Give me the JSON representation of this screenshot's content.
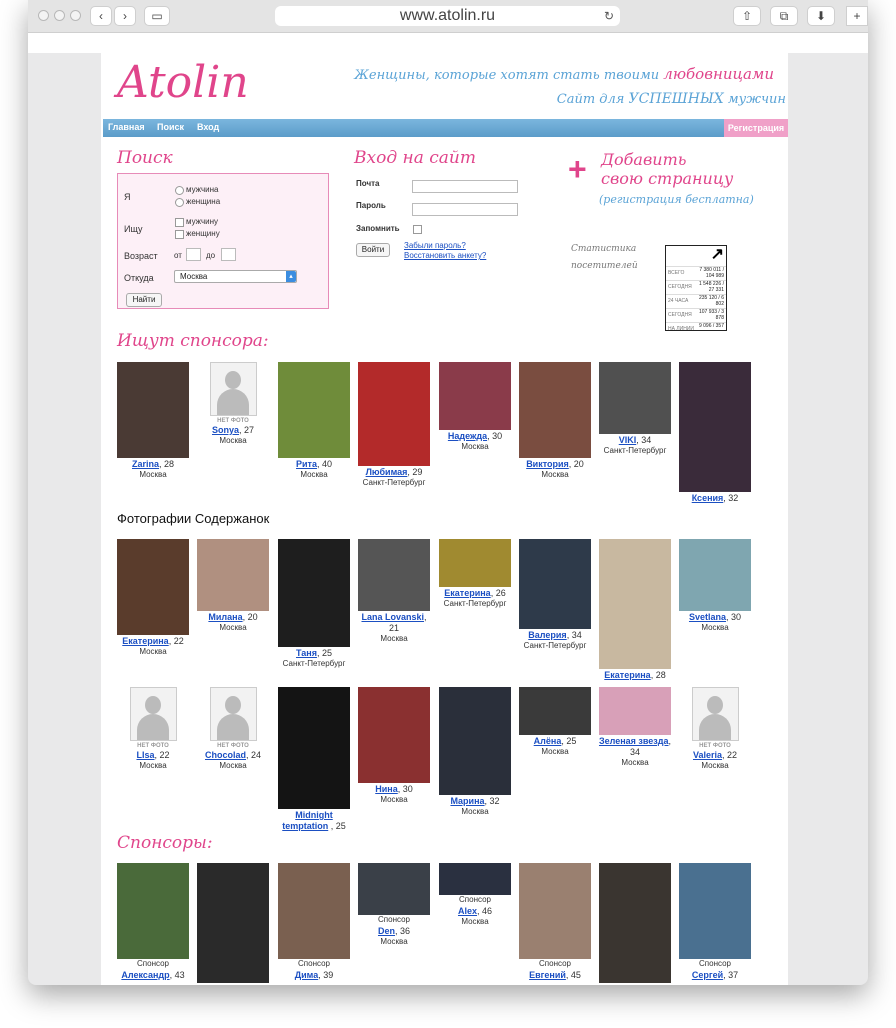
{
  "browser": {
    "url": "www.atolin.ru",
    "back_icon": "chevron-left",
    "forward_icon": "chevron-right",
    "new_tab": "+"
  },
  "header": {
    "logo": "Atolin",
    "tagline_prefix": "Женщины, которые хотят стать твоими",
    "tagline_highlight": "любовницами",
    "tagline2_prefix": "Сайт для",
    "tagline2_highlight": "УСПЕШНЫХ",
    "tagline2_suffix": "мужчин"
  },
  "nav": {
    "items": [
      "Главная",
      "Поиск",
      "Вход"
    ],
    "register": "Регистрация"
  },
  "search": {
    "title": "Поиск",
    "i_label": "Я",
    "i_options": [
      "мужчина",
      "женщина"
    ],
    "seek_label": "Ищу",
    "seek_options": [
      "мужчину",
      "женщину"
    ],
    "age_label": "Возраст",
    "age_from": "от",
    "age_to": "до",
    "from_label": "Откуда",
    "city_value": "Москва",
    "submit": "Найти"
  },
  "login": {
    "title": "Вход на сайт",
    "email_label": "Почта",
    "password_label": "Пароль",
    "remember_label": "Запомнить",
    "submit": "Войти",
    "forgot": "Забыли пароль?",
    "restore": "Восстановить анкету?"
  },
  "add_page": {
    "line1": "Добавить",
    "line2": "свою страницу",
    "note": "(регистрация бесплатна)"
  },
  "stats": {
    "label": "Статистика посетителей",
    "rows": [
      {
        "label": "ВСЕГО",
        "value": "7 380 011 / 104 989"
      },
      {
        "label": "СЕГОДНЯ",
        "value": "1 548 226 / 27 331"
      },
      {
        "label": "24 ЧАСА",
        "value": "235 120 / 6 802"
      },
      {
        "label": "СЕГОДНЯ",
        "value": "107 933 / 3 878"
      },
      {
        "label": "НА ЛИНИИ",
        "value": "9 096 / 357"
      }
    ]
  },
  "sponsor_seek": {
    "title": "Ищут спонсора:",
    "items": [
      {
        "name": "Zarina",
        "age": ", 28",
        "city": "Москва",
        "photo": "#4a3a34"
      },
      {
        "name": "Sonya",
        "age": ", 27",
        "city": "Москва",
        "nophoto": "НЕТ ФОТО"
      },
      {
        "name": "Рита",
        "age": ", 40",
        "city": "Москва",
        "photo": "#6f8c3a"
      },
      {
        "name": "Любимая",
        "age": ", 29",
        "city": "Санкт-Петербург",
        "photo": "#b32a2a"
      },
      {
        "name": "Надежда",
        "age": ", 30",
        "city": "Москва",
        "photo": "#8a3b4a"
      },
      {
        "name": "Виктория",
        "age": ", 20",
        "city": "Москва",
        "photo": "#7a4d40"
      },
      {
        "name": "VIKI",
        "age": ", 34",
        "city": "Санкт-Петербург",
        "photo": "#505050"
      },
      {
        "name": "Ксения",
        "age": ", 32",
        "city": "",
        "photo": "#3a2b3a"
      }
    ]
  },
  "kept_women": {
    "title": "Фотографии Содержанок",
    "row1": [
      {
        "name": "Екатерина",
        "age": ", 22",
        "city": "Москва",
        "photo": "#5a3c2c"
      },
      {
        "name": "Милана",
        "age": ", 20",
        "city": "Москва",
        "photo": "#b09080"
      },
      {
        "name": "Таня",
        "age": ", 25",
        "city": "Санкт-Петербург",
        "photo": "#1e1e1e"
      },
      {
        "name": "Lana Lovanski",
        "age": ", 21",
        "city": "Москва",
        "photo": "#555555"
      },
      {
        "name": "Екатерина",
        "age": ", 26",
        "city": "Санкт-Петербург",
        "photo": "#a08a30"
      },
      {
        "name": "Валерия",
        "age": ", 34",
        "city": "Санкт-Петербург",
        "photo": "#2e3a4a"
      },
      {
        "name": "Екатерина",
        "age": ", 28",
        "city": "",
        "photo": "#c8b8a0"
      },
      {
        "name": "Svetlana",
        "age": ", 30",
        "city": "Москва",
        "photo": "#7fa6b0"
      }
    ],
    "row2": [
      {
        "name": "LIsa",
        "age": ", 22",
        "city": "Москва",
        "nophoto": "НЕТ ФОТО"
      },
      {
        "name": "Chocolad",
        "age": ", 24",
        "city": "Москва",
        "nophoto": "НЕТ ФОТО"
      },
      {
        "name": "Midnight temptation",
        "age": " , 25",
        "city": "",
        "photo": "#141414"
      },
      {
        "name": "Нина",
        "age": ", 30",
        "city": "Москва",
        "photo": "#8a3030"
      },
      {
        "name": "Марина",
        "age": ", 32",
        "city": "Москва",
        "photo": "#2a2f3a"
      },
      {
        "name": "Алёна",
        "age": ", 25",
        "city": "Москва",
        "photo": "#3a3a3a"
      },
      {
        "name": "Зеленая звезда",
        "age": ", 34",
        "city": "Москва",
        "photo": "#d8a0b8"
      },
      {
        "name": "Valeria",
        "age": ", 22",
        "city": "Москва",
        "nophoto": "НЕТ ФОТО"
      }
    ]
  },
  "sponsors": {
    "title": "Спонсоры:",
    "items": [
      {
        "role": "Спонсор",
        "name": "Александр",
        "age": ", 43",
        "city": "",
        "photo": "#4a6a3a"
      },
      {
        "role": "",
        "name": "",
        "age": "",
        "city": "",
        "photo": "#2a2a2a"
      },
      {
        "role": "Спонсор",
        "name": "Дима",
        "age": ", 39",
        "city": "",
        "photo": "#7a6050"
      },
      {
        "role": "Спонсор",
        "name": "Den",
        "age": ", 36",
        "city": "Москва",
        "photo": "#3a4048"
      },
      {
        "role": "Спонсор",
        "name": "Alex",
        "age": ", 46",
        "city": "Москва",
        "photo": "#2a3040"
      },
      {
        "role": "Спонсор",
        "name": "Евгений",
        "age": ", 45",
        "city": "",
        "photo": "#9a8070"
      },
      {
        "role": "",
        "name": "",
        "age": "",
        "city": "",
        "photo": "#3a3530"
      },
      {
        "role": "Спонсор",
        "name": "Сергей",
        "age": ", 37",
        "city": "",
        "photo": "#4a7090"
      }
    ]
  }
}
